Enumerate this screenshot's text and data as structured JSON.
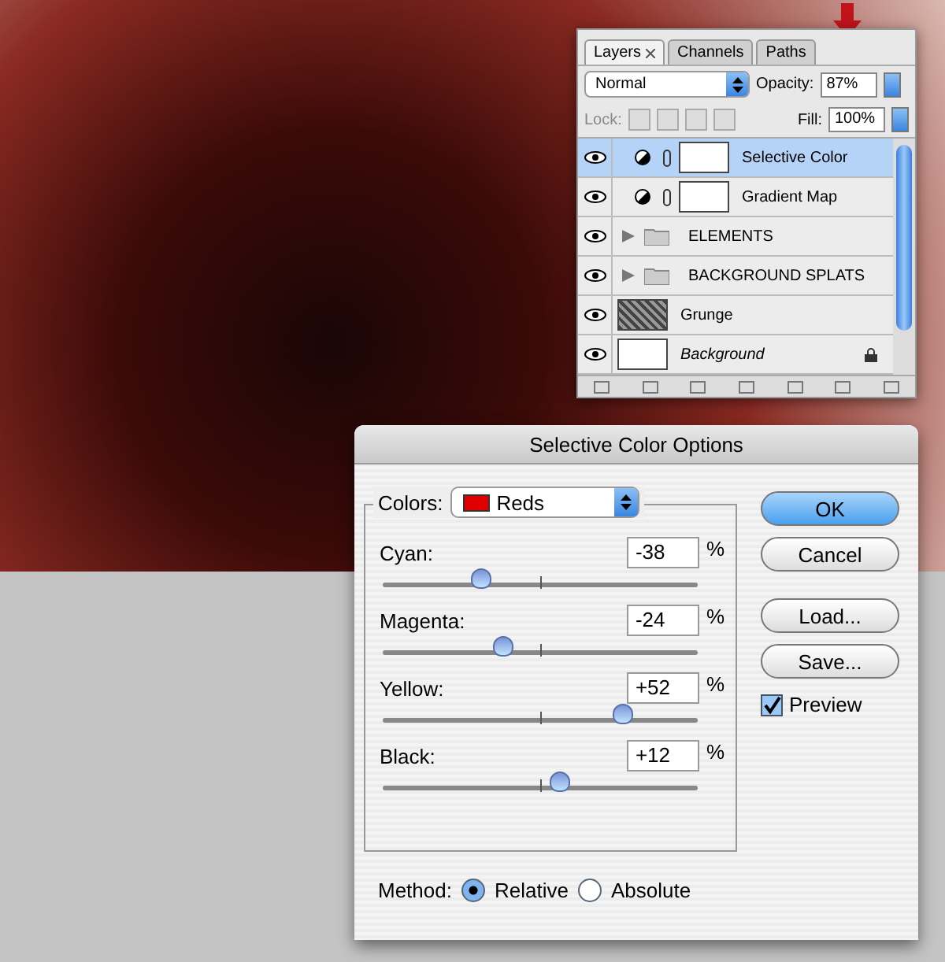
{
  "layers_panel": {
    "tabs": [
      {
        "label": "Layers",
        "selected": true,
        "closable": true
      },
      {
        "label": "Channels",
        "selected": false,
        "closable": false
      },
      {
        "label": "Paths",
        "selected": false,
        "closable": false
      }
    ],
    "blend_mode": "Normal",
    "opacity_label": "Opacity:",
    "opacity": "87%",
    "lock_label": "Lock:",
    "fill_label": "Fill:",
    "fill": "100%",
    "layers": [
      {
        "kind": "adjustment",
        "name": "Selective Color",
        "selected": true,
        "visible": true,
        "locked": false,
        "italic": false
      },
      {
        "kind": "adjustment",
        "name": "Gradient Map",
        "selected": false,
        "visible": true,
        "locked": false,
        "italic": false
      },
      {
        "kind": "group",
        "name": "ELEMENTS",
        "selected": false,
        "visible": true,
        "locked": false,
        "italic": false
      },
      {
        "kind": "group",
        "name": "BACKGROUND SPLATS",
        "selected": false,
        "visible": true,
        "locked": false,
        "italic": false
      },
      {
        "kind": "texture",
        "name": "Grunge",
        "selected": false,
        "visible": true,
        "locked": false,
        "italic": false
      },
      {
        "kind": "blank",
        "name": "Background",
        "selected": false,
        "visible": true,
        "locked": true,
        "italic": true
      }
    ]
  },
  "dialog": {
    "title": "Selective Color Options",
    "colors_label": "Colors:",
    "colors_value": "Reds",
    "sliders": [
      {
        "label": "Cyan:",
        "value": "-38",
        "unit": "%",
        "level": 0.31
      },
      {
        "label": "Magenta:",
        "value": "-24",
        "unit": "%",
        "level": 0.38
      },
      {
        "label": "Yellow:",
        "value": "+52",
        "unit": "%",
        "level": 0.76
      },
      {
        "label": "Black:",
        "value": "+12",
        "unit": "%",
        "level": 0.56
      }
    ],
    "buttons": [
      {
        "label": "OK",
        "default": true
      },
      {
        "label": "Cancel",
        "default": false
      },
      {
        "label": "Load...",
        "default": false
      },
      {
        "label": "Save...",
        "default": false
      }
    ],
    "preview": {
      "label": "Preview",
      "checked": true
    },
    "method_label": "Method:",
    "methods": [
      {
        "label": "Relative",
        "selected": true
      },
      {
        "label": "Absolute",
        "selected": false
      }
    ]
  }
}
